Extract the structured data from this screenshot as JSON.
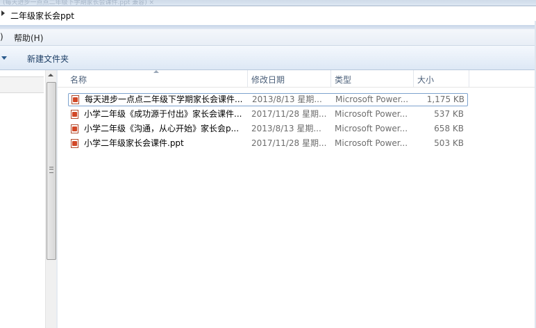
{
  "window": {
    "title_ghost": "(每天进步一点点二年级下学期家长会课件.ppt 兼容) ×"
  },
  "address_bar": {
    "crumb": "二年级家长会ppt"
  },
  "menu": {
    "paren": ")",
    "help_label": "帮助(H)"
  },
  "toolbar": {
    "new_folder_label": "新建文件夹"
  },
  "columns": {
    "name": "名称",
    "date": "修改日期",
    "type": "类型",
    "size": "大小"
  },
  "files": [
    {
      "name": "每天进步一点点二年级下学期家长会课件...",
      "date": "2013/8/13 星期...",
      "type": "Microsoft Power...",
      "size": "1,175 KB"
    },
    {
      "name": "小学二年级《成功源于付出》家长会课件...",
      "date": "2017/11/28 星期...",
      "type": "Microsoft Power...",
      "size": "537 KB"
    },
    {
      "name": "小学二年级《沟通，从心开始》家长会p...",
      "date": "2013/8/13 星期...",
      "type": "Microsoft Power...",
      "size": "658 KB"
    },
    {
      "name": "小学二年级家长会课件.ppt",
      "date": "2017/11/28 星期...",
      "type": "Microsoft Power...",
      "size": "503 KB"
    }
  ]
}
